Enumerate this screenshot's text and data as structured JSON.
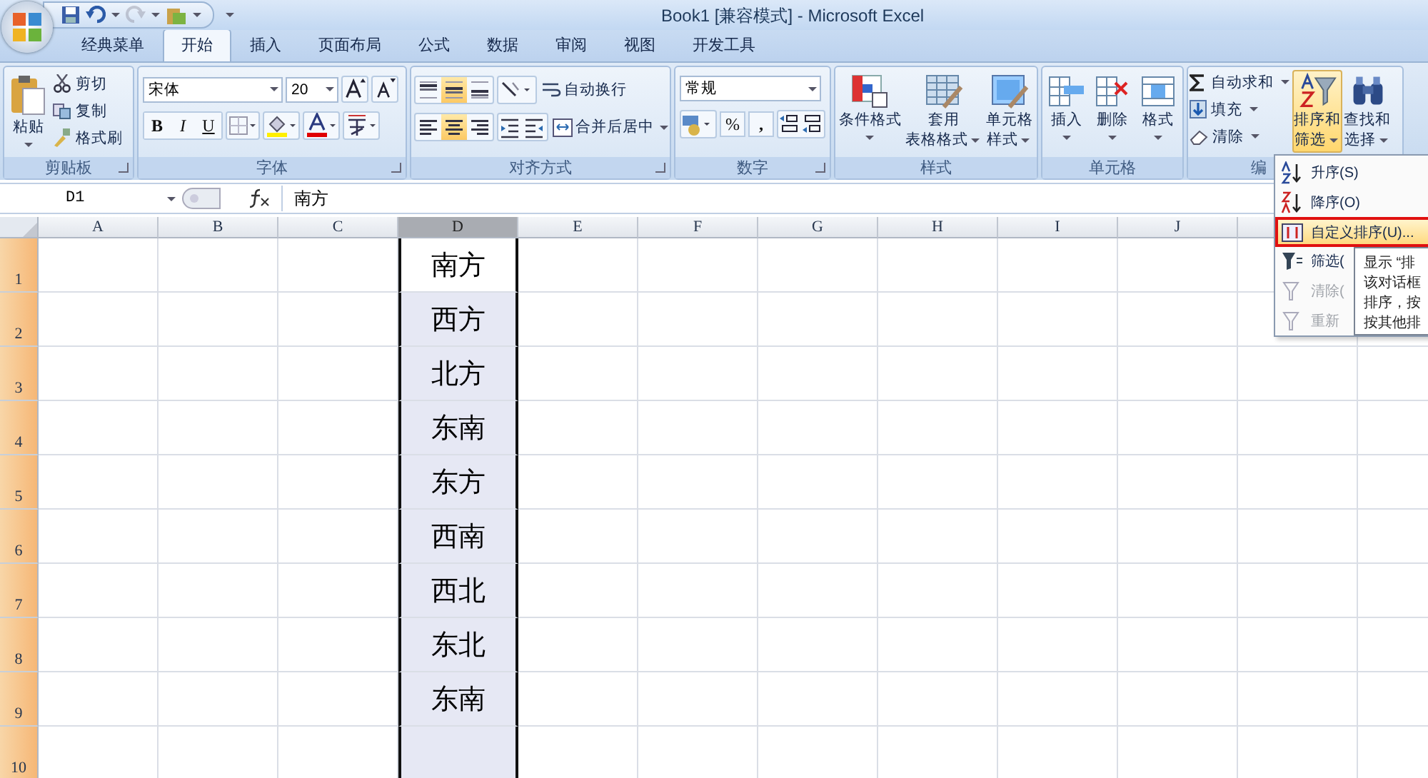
{
  "title_bar": {
    "title": "Book1  [兼容模式] - Microsoft Excel"
  },
  "tabs": [
    {
      "label": "经典菜单",
      "selected": false
    },
    {
      "label": "开始",
      "selected": true
    },
    {
      "label": "插入",
      "selected": false
    },
    {
      "label": "页面布局",
      "selected": false
    },
    {
      "label": "公式",
      "selected": false
    },
    {
      "label": "数据",
      "selected": false
    },
    {
      "label": "审阅",
      "selected": false
    },
    {
      "label": "视图",
      "selected": false
    },
    {
      "label": "开发工具",
      "selected": false
    }
  ],
  "ribbon": {
    "clipboard": {
      "label": "剪贴板",
      "paste": "粘贴",
      "cut": "剪切",
      "copy": "复制",
      "format_painter": "格式刷"
    },
    "font": {
      "label": "字体",
      "font_name": "宋体",
      "font_size": "20",
      "bold": "B",
      "italic": "I",
      "underline": "U"
    },
    "alignment": {
      "label": "对齐方式",
      "vertical_align": [
        {
          "selected": false
        },
        {
          "selected": true
        },
        {
          "selected": false
        }
      ],
      "horizontal_align": [
        {
          "selected": false
        },
        {
          "selected": true
        },
        {
          "selected": false
        }
      ],
      "wrap_text": "自动换行",
      "merge_center": "合并后居中"
    },
    "number": {
      "label": "数字",
      "format": "常规",
      "percent": "%",
      "comma": ","
    },
    "styles": {
      "label": "样式",
      "conditional_format": [
        "条件格式"
      ],
      "table_format": [
        "套用",
        "表格格式"
      ],
      "cell_styles": [
        "单元格",
        "样式"
      ]
    },
    "cells": {
      "label": "单元格",
      "insert": "插入",
      "delete": "删除",
      "format": "格式"
    },
    "editing": {
      "label": "编",
      "autosum": "自动求和",
      "fill": "填充",
      "clear": "清除",
      "sort_filter": {
        "lines": [
          "排序和",
          "筛选"
        ],
        "active": true
      },
      "find_select": [
        "查找和",
        "选择"
      ]
    }
  },
  "formula_bar": {
    "name_box": "D1",
    "formula": "南方"
  },
  "sheet": {
    "columns": [
      {
        "label": "A",
        "selected": false
      },
      {
        "label": "B",
        "selected": false
      },
      {
        "label": "C",
        "selected": false
      },
      {
        "label": "D",
        "selected": true
      },
      {
        "label": "E",
        "selected": false
      },
      {
        "label": "F",
        "selected": false
      },
      {
        "label": "G",
        "selected": false
      },
      {
        "label": "H",
        "selected": false
      },
      {
        "label": "I",
        "selected": false
      },
      {
        "label": "J",
        "selected": false
      }
    ],
    "rows": [
      {
        "label": "1",
        "cells": {
          "D": {
            "text": "南方",
            "active": true
          }
        }
      },
      {
        "label": "2",
        "cells": {
          "D": {
            "text": "西方",
            "active": false
          }
        }
      },
      {
        "label": "3",
        "cells": {
          "D": {
            "text": "北方",
            "active": false
          }
        }
      },
      {
        "label": "4",
        "cells": {
          "D": {
            "text": "东南",
            "active": false
          }
        }
      },
      {
        "label": "5",
        "cells": {
          "D": {
            "text": "东方",
            "active": false
          }
        }
      },
      {
        "label": "6",
        "cells": {
          "D": {
            "text": "西南",
            "active": false
          }
        }
      },
      {
        "label": "7",
        "cells": {
          "D": {
            "text": "西北",
            "active": false
          }
        }
      },
      {
        "label": "8",
        "cells": {
          "D": {
            "text": "东北",
            "active": false
          }
        }
      },
      {
        "label": "9",
        "cells": {
          "D": {
            "text": "东南",
            "active": false
          }
        }
      },
      {
        "label": "10"
      }
    ]
  },
  "sort_menu": {
    "items": [
      {
        "label": "升序(S)",
        "highlighted": false,
        "disabled": false
      },
      {
        "label": "降序(O)",
        "highlighted": false,
        "disabled": false
      },
      {
        "label": "自定义排序(U)...",
        "highlighted": true,
        "disabled": false
      },
      {
        "label": "筛选(",
        "highlighted": false,
        "disabled": false
      },
      {
        "label": "清除(",
        "highlighted": false,
        "disabled": true
      },
      {
        "label": "重新",
        "highlighted": false,
        "disabled": true
      }
    ],
    "tooltip": [
      "显示 “排",
      "该对话框",
      "排序，按",
      "按其他排"
    ]
  }
}
